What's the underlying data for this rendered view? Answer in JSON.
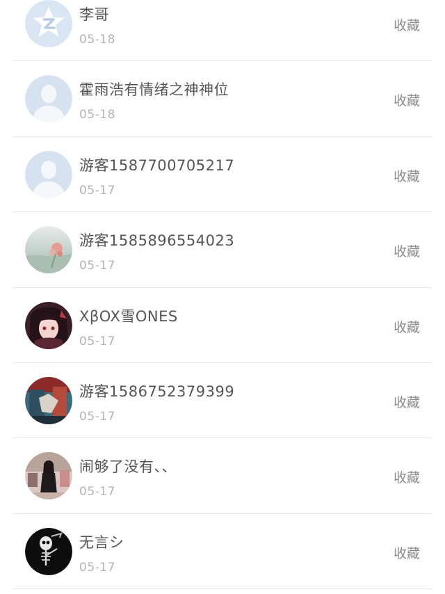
{
  "fav_label": "收藏",
  "items": [
    {
      "name": "李哥",
      "date": "05-18",
      "avatar": "qq-star-avatar"
    },
    {
      "name": "霍雨浩有情绪之神神位",
      "date": "05-18",
      "avatar": "default-person-avatar"
    },
    {
      "name": "游客1587700705217",
      "date": "05-17",
      "avatar": "default-person-avatar"
    },
    {
      "name": "游客1585896554023",
      "date": "05-17",
      "avatar": "flower-photo-avatar"
    },
    {
      "name": "XβOX雪ONES",
      "date": "05-17",
      "avatar": "anime-girl-avatar"
    },
    {
      "name": "游客1586752379399",
      "date": "05-17",
      "avatar": "anime-scene-avatar"
    },
    {
      "name": "闹够了没有、、",
      "date": "05-17",
      "avatar": "woman-photo-avatar"
    },
    {
      "name": "无言シ",
      "date": "05-17",
      "avatar": "skeleton-avatar"
    }
  ]
}
